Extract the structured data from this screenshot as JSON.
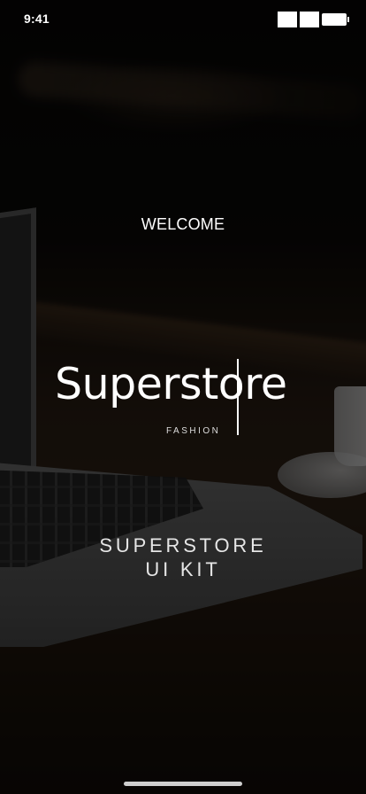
{
  "status_bar": {
    "time": "9:41",
    "icons": [
      "signal-icon",
      "wifi-icon",
      "battery-icon"
    ]
  },
  "screen": {
    "welcome": "WELCOME",
    "logo": {
      "word": "Superstore",
      "sub": "FASHION"
    },
    "kit_title_line1": "SUPERSTORE",
    "kit_title_line2": "UI KIT"
  },
  "colors": {
    "text": "#ffffff",
    "overlay": "#000000"
  }
}
